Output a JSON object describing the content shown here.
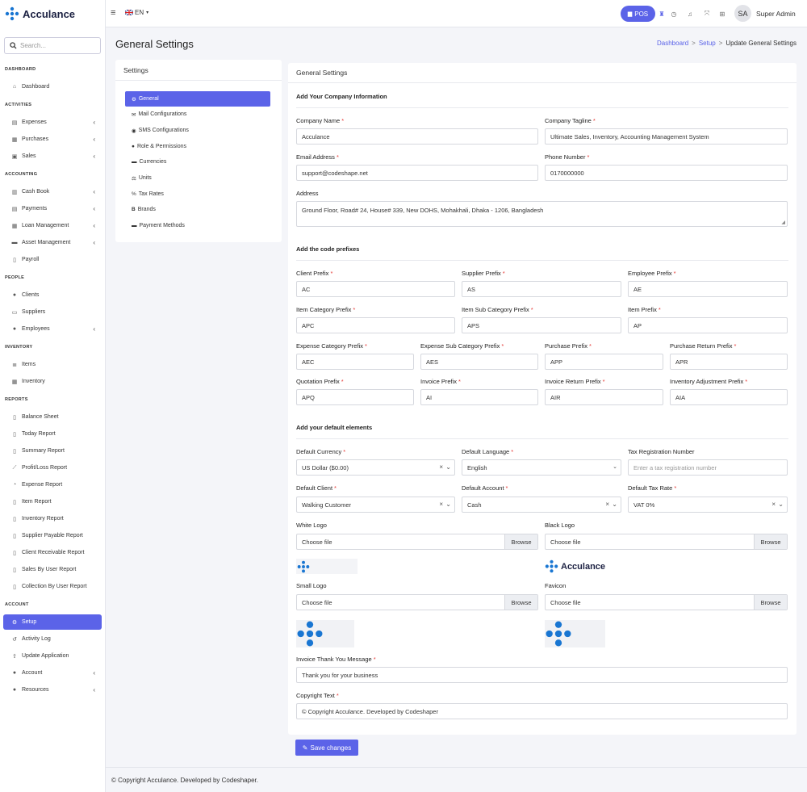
{
  "brand": {
    "name": "Acculance",
    "accent": "#5b63e8"
  },
  "sidebar": {
    "search_placeholder": "Search...",
    "sections": {
      "dashboard": "DASHBOARD",
      "activities": "ACTIVITIES",
      "accounting": "ACCOUNTING",
      "people": "PEOPLE",
      "inventory": "INVENTORY",
      "reports": "REPORTS",
      "account": "ACCOUNT"
    },
    "items": {
      "dashboard": "Dashboard",
      "expenses": "Expenses",
      "purchases": "Purchases",
      "sales": "Sales",
      "cash_book": "Cash Book",
      "payments": "Payments",
      "loan_management": "Loan Management",
      "asset_management": "Asset Management",
      "payroll": "Payroll",
      "clients": "Clients",
      "suppliers": "Suppliers",
      "employees": "Employees",
      "items": "Items",
      "inventory": "Inventory",
      "balance_sheet": "Balance Sheet",
      "today_report": "Today Report",
      "summary_report": "Summary Report",
      "profit_loss_report": "Profit/Loss Report",
      "expense_report": "Expense Report",
      "item_report": "Item Report",
      "inventory_report": "Inventory Report",
      "supplier_payable_report": "Supplier Payable Report",
      "client_receivable_report": "Client Receivable Report",
      "sales_by_user_report": "Sales By User Report",
      "collection_by_user_report": "Collection By User Report",
      "setup": "Setup",
      "activity_log": "Activity Log",
      "update_application": "Update Application",
      "account": "Account",
      "resources": "Resources"
    }
  },
  "topbar": {
    "language": "EN",
    "pos_label": "POS",
    "avatar_initials": "SA",
    "user_name": "Super Admin"
  },
  "page": {
    "title": "General Settings",
    "breadcrumb": {
      "dashboard": "Dashboard",
      "setup": "Setup",
      "current": "Update General Settings"
    }
  },
  "settings_menu": {
    "title": "Settings",
    "items": {
      "general": "General",
      "mail": "Mail Configurations",
      "sms": "SMS Configurations",
      "roles": "Role & Permissions",
      "currencies": "Currencies",
      "units": "Units",
      "tax_rates": "Tax Rates",
      "brands": "Brands",
      "payment_methods": "Payment Methods"
    }
  },
  "form": {
    "title": "General Settings",
    "company_section": "Add Your Company Information",
    "company_name": {
      "label": "Company Name",
      "value": "Acculance"
    },
    "company_tagline": {
      "label": "Company Tagline",
      "value": "Ultimate Sales, Inventory, Accounting Management System"
    },
    "email": {
      "label": "Email Address",
      "value": "support@codeshape.net"
    },
    "phone": {
      "label": "Phone Number",
      "value": "0170000000"
    },
    "address": {
      "label": "Address",
      "value": "Ground Floor, Road# 24, House# 339, New DOHS, Mohakhali, Dhaka - 1206, Bangladesh"
    },
    "prefix_section": "Add the code prefixes",
    "prefixes": {
      "client": {
        "label": "Client Prefix",
        "value": "AC"
      },
      "supplier": {
        "label": "Supplier Prefix",
        "value": "AS"
      },
      "employee": {
        "label": "Employee Prefix",
        "value": "AE"
      },
      "item_category": {
        "label": "Item Category Prefix",
        "value": "APC"
      },
      "item_sub_category": {
        "label": "Item Sub Category Prefix",
        "value": "APS"
      },
      "item": {
        "label": "Item Prefix",
        "value": "AP"
      },
      "expense_category": {
        "label": "Expense Category Prefix",
        "value": "AEC"
      },
      "expense_sub_category": {
        "label": "Expense Sub Category Prefix",
        "value": "AES"
      },
      "purchase": {
        "label": "Purchase Prefix",
        "value": "APP"
      },
      "purchase_return": {
        "label": "Purchase Return Prefix",
        "value": "APR"
      },
      "quotation": {
        "label": "Quotation Prefix",
        "value": "APQ"
      },
      "invoice": {
        "label": "Invoice Prefix",
        "value": "AI"
      },
      "invoice_return": {
        "label": "Invoice Return Prefix",
        "value": "AIR"
      },
      "inventory_adjustment": {
        "label": "Inventory Adjustment Prefix",
        "value": "AIA"
      }
    },
    "defaults_section": "Add your default elements",
    "default_currency": {
      "label": "Default Currency",
      "value": "US Dollar ($0.00)"
    },
    "default_language": {
      "label": "Default Language",
      "value": "English"
    },
    "tax_registration": {
      "label": "Tax Registration Number",
      "placeholder": "Enter a tax registration number"
    },
    "default_client": {
      "label": "Default Client",
      "value": "Walking Customer"
    },
    "default_account": {
      "label": "Default Account",
      "value": "Cash"
    },
    "default_tax_rate": {
      "label": "Default Tax Rate",
      "value": "VAT 0%"
    },
    "white_logo": {
      "label": "White Logo",
      "placeholder": "Choose file"
    },
    "black_logo": {
      "label": "Black Logo",
      "placeholder": "Choose file"
    },
    "small_logo": {
      "label": "Small Logo",
      "placeholder": "Choose file"
    },
    "favicon": {
      "label": "Favicon",
      "placeholder": "Choose file"
    },
    "browse_label": "Browse",
    "thank_you": {
      "label": "Invoice Thank You Message",
      "value": "Thank you for your business"
    },
    "copyright": {
      "label": "Copyright Text",
      "value": "© Copyright Acculance. Developed by Codeshaper"
    },
    "save_label": "Save changes"
  },
  "footer": {
    "text": "© Copyright Acculance. Developed by Codeshaper."
  }
}
